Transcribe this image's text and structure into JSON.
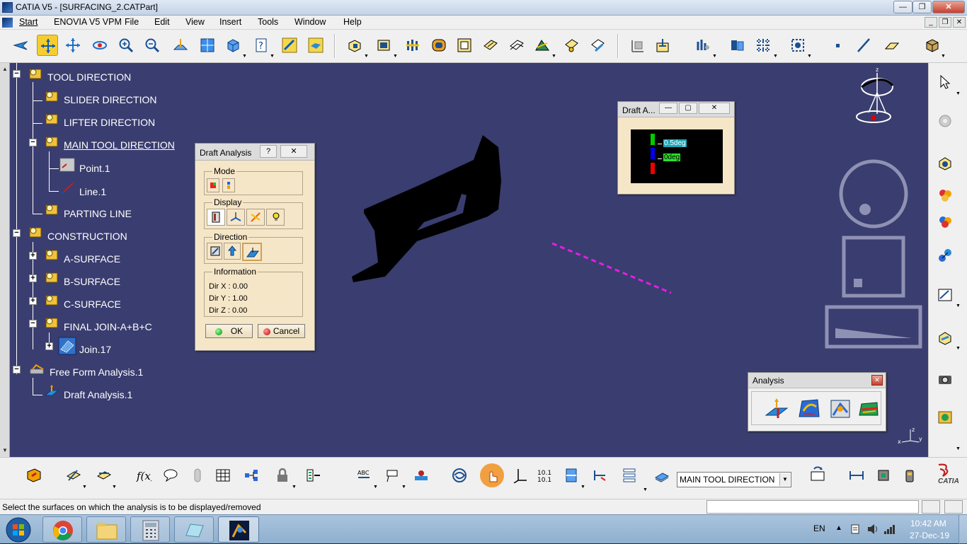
{
  "window": {
    "title": "CATIA V5 - [SURFACING_2.CATPart]",
    "min": "—",
    "max": "❐",
    "close": "✕"
  },
  "menu": {
    "items": [
      "Start",
      "ENOVIA V5 VPM",
      "File",
      "Edit",
      "View",
      "Insert",
      "Tools",
      "Window",
      "Help"
    ],
    "mdi_min": "_",
    "mdi_restore": "❐",
    "mdi_close": "✕"
  },
  "tree": {
    "items": [
      {
        "label": "TOOL DIRECTION",
        "icon": "geometrical-set-icon"
      },
      {
        "label": "SLIDER DIRECTION",
        "icon": "geometrical-set-icon"
      },
      {
        "label": "LIFTER DIRECTION",
        "icon": "geometrical-set-icon"
      },
      {
        "label": "MAIN TOOL DIRECTION",
        "icon": "geometrical-set-icon"
      },
      {
        "label": "Point.1",
        "icon": "point-icon"
      },
      {
        "label": "Line.1",
        "icon": "line-icon"
      },
      {
        "label": "PARTING LINE",
        "icon": "geometrical-set-icon"
      },
      {
        "label": "CONSTRUCTION",
        "icon": "geometrical-set-icon"
      },
      {
        "label": "A-SURFACE",
        "icon": "geometrical-set-icon"
      },
      {
        "label": "B-SURFACE",
        "icon": "geometrical-set-icon"
      },
      {
        "label": "C-SURFACE",
        "icon": "geometrical-set-icon"
      },
      {
        "label": "FINAL JOIN-A+B+C",
        "icon": "geometrical-set-icon"
      },
      {
        "label": "Join.17",
        "icon": "join-icon"
      },
      {
        "label": "Free Form Analysis.1",
        "icon": "analysis-set-icon"
      },
      {
        "label": "Draft Analysis.1",
        "icon": "draft-analysis-icon"
      }
    ]
  },
  "draft_dialog": {
    "title": "Draft Analysis",
    "help": "?",
    "close": "✕",
    "mode_label": "Mode",
    "display_label": "Display",
    "direction_label": "Direction",
    "information_label": "Information",
    "dir_x": "Dir X : 0.00",
    "dir_y": "Dir Y : 1.00",
    "dir_z": "Dir Z : 0.00",
    "ok": "OK",
    "cancel": "Cancel"
  },
  "color_scale": {
    "title": "Draft A...",
    "label_1": "0.5deg",
    "label_2": "0deg",
    "colors": [
      "#00cc00",
      "#0000ee",
      "#ee0000"
    ]
  },
  "analysis_toolbar": {
    "title": "Analysis",
    "close": "✕"
  },
  "bottom": {
    "combo_value": "MAIN TOOL DIRECTION",
    "logo": "CATIA"
  },
  "status": {
    "message": "Select the surfaces on which the analysis is to be displayed/removed"
  },
  "taskbar": {
    "lang": "EN",
    "time": "10:42 AM",
    "date": "27-Dec-19"
  }
}
